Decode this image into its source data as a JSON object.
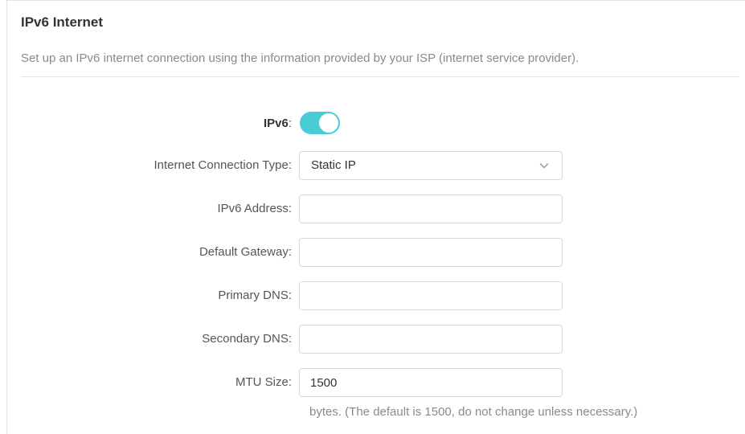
{
  "section": {
    "title": "IPv6 Internet",
    "description": "Set up an IPv6 internet connection using the information provided by your ISP (internet service provider)."
  },
  "form": {
    "ipv6": {
      "label": "IPv6",
      "colon": ":",
      "enabled": true
    },
    "connection_type": {
      "label": "Internet Connection Type:",
      "value": "Static IP"
    },
    "ipv6_address": {
      "label": "IPv6 Address:",
      "value": ""
    },
    "default_gateway": {
      "label": "Default Gateway:",
      "value": ""
    },
    "primary_dns": {
      "label": "Primary DNS:",
      "value": ""
    },
    "secondary_dns": {
      "label": "Secondary DNS:",
      "value": ""
    },
    "mtu_size": {
      "label": "MTU Size:",
      "value": "1500",
      "hint": "bytes. (The default is 1500, do not change unless necessary.)"
    }
  },
  "colors": {
    "toggle_on": "#4acbd6"
  },
  "icons": {
    "dropdown": "chevron-down-icon"
  }
}
